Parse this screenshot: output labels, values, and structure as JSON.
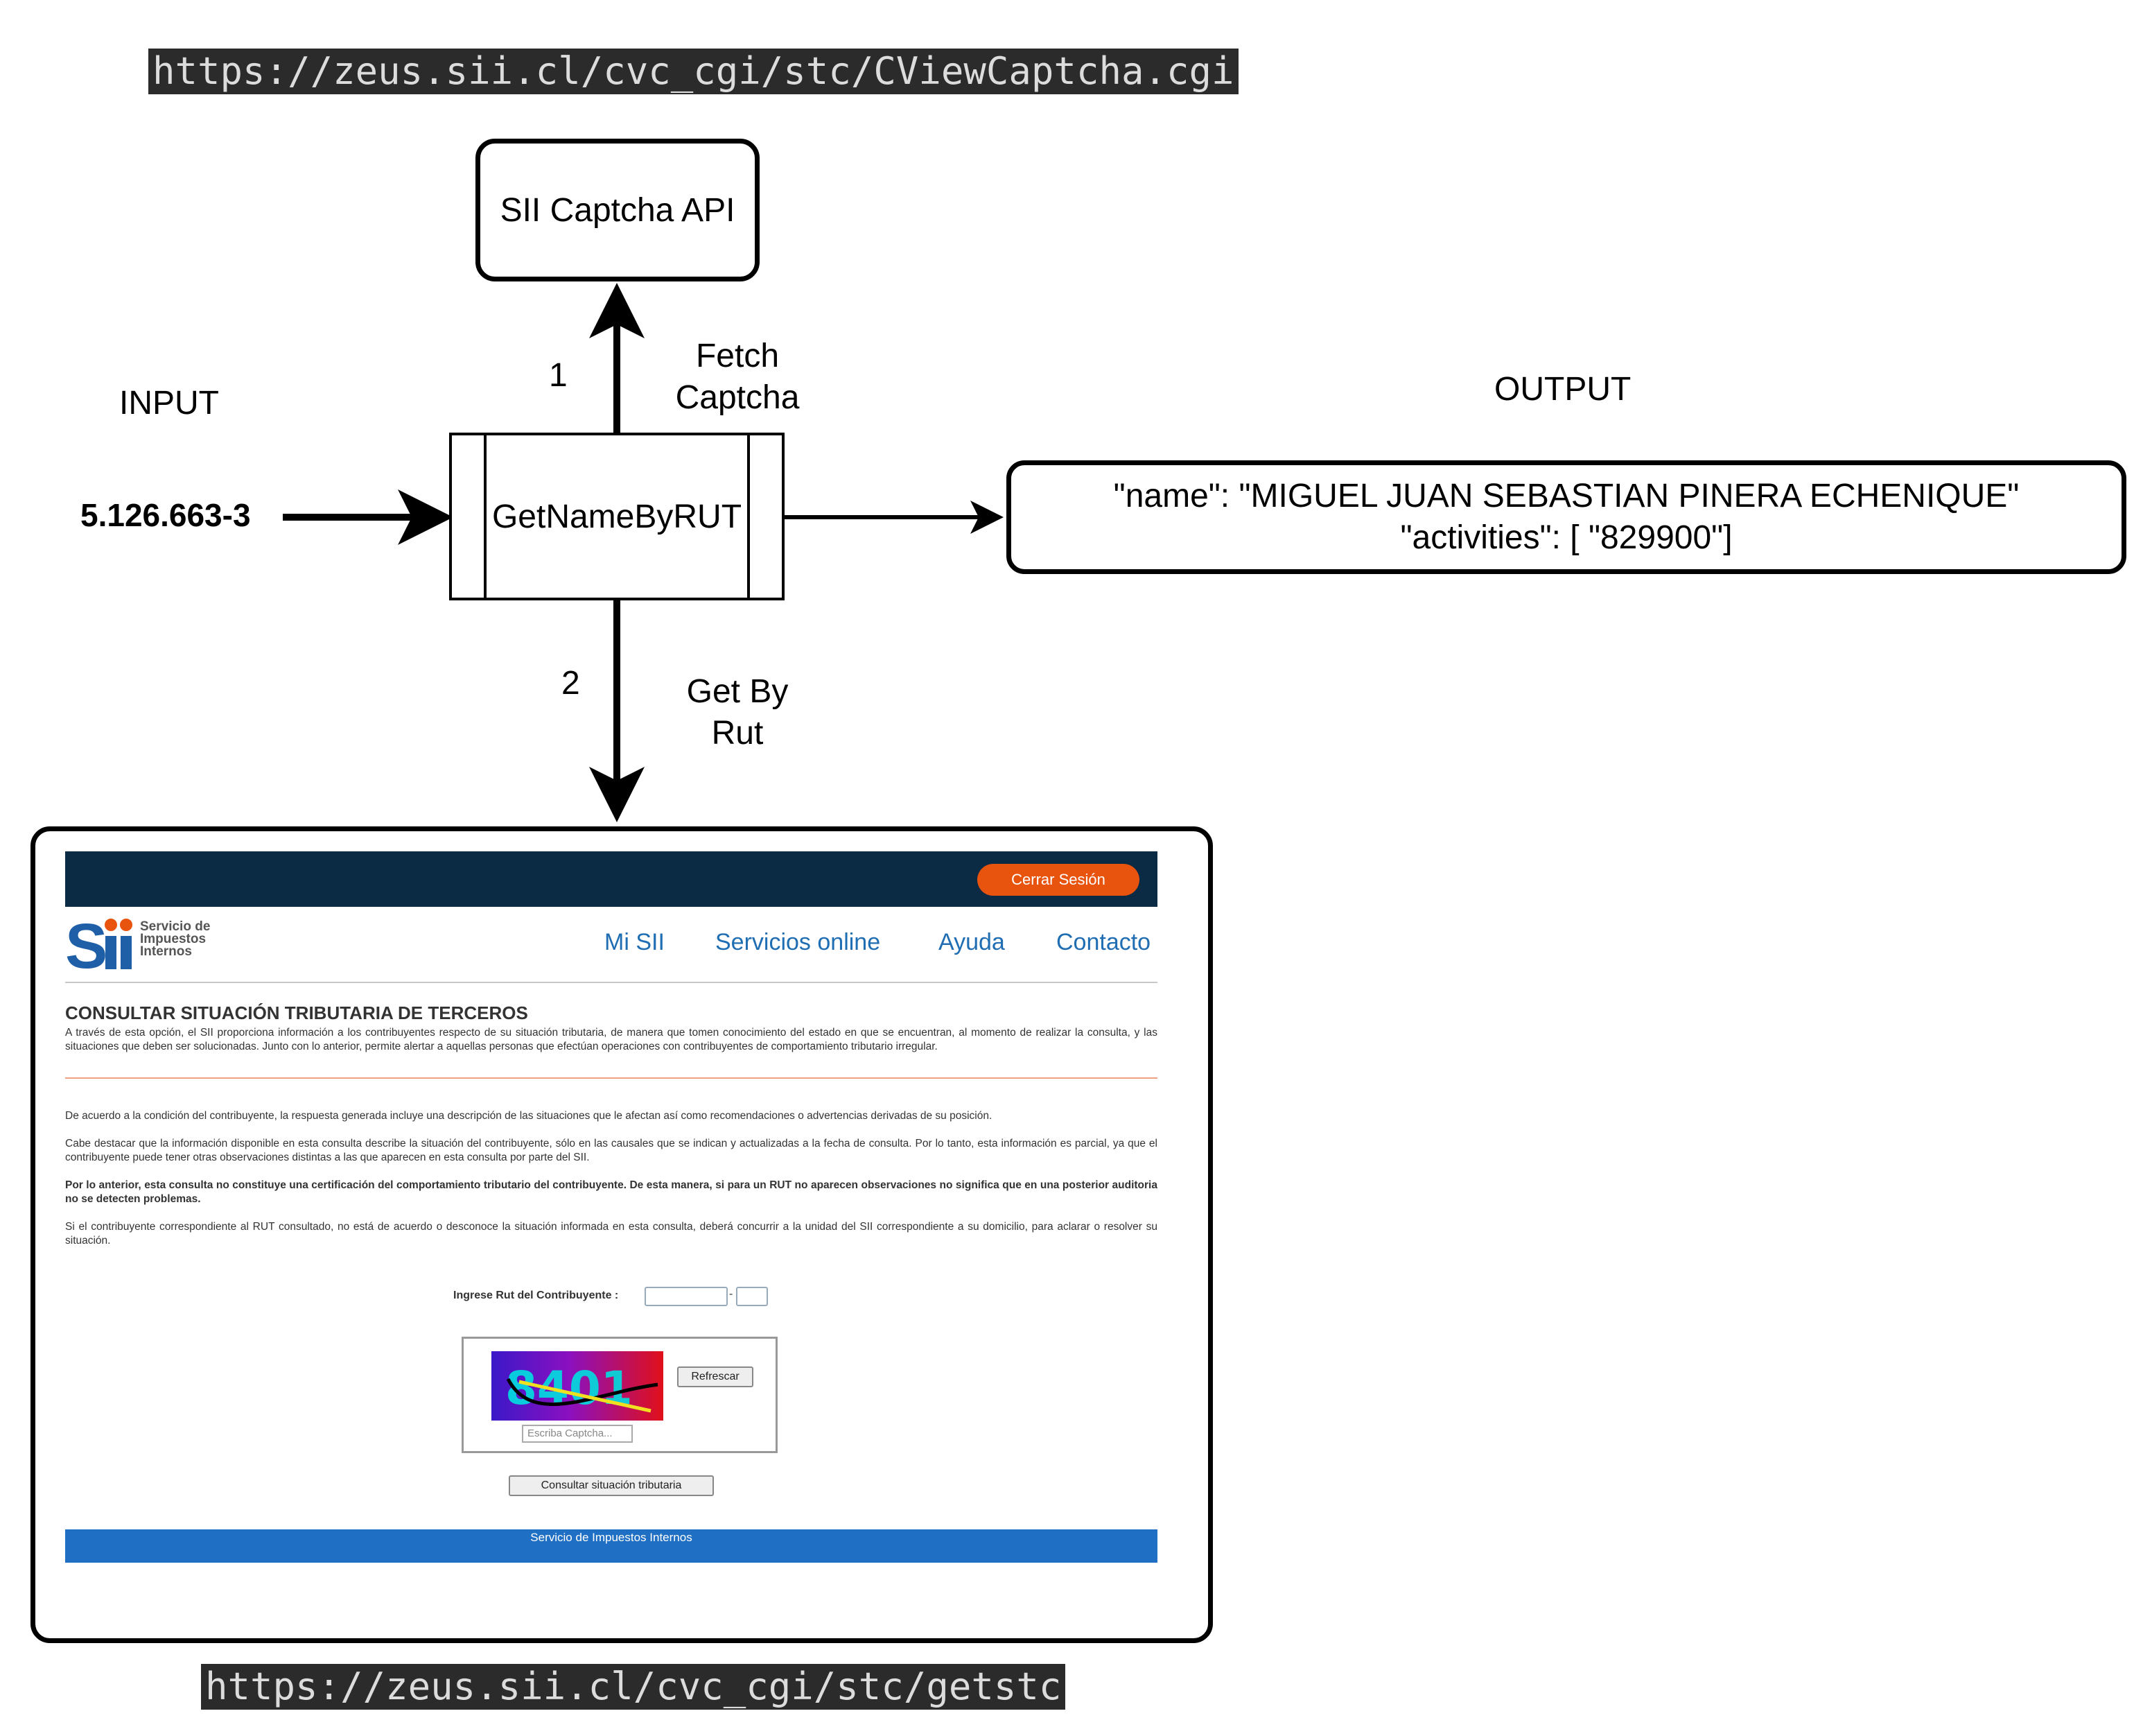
{
  "urls": {
    "captcha": "https://zeus.sii.cl/cvc_cgi/stc/CViewCaptcha.cgi",
    "getstc": "https://zeus.sii.cl/cvc_cgi/stc/getstc"
  },
  "nodes": {
    "captcha_api": "SII Captcha API",
    "get_name": "GetNameByRUT"
  },
  "labels": {
    "input": "INPUT",
    "output": "OUTPUT",
    "step1_num": "1",
    "step1_line1": "Fetch",
    "step1_line2": "Captcha",
    "step2_num": "2",
    "step2_line1": "Get By",
    "step2_line2": "Rut"
  },
  "input_value": "5.126.663-3",
  "output": {
    "line1": "\"name\": \"MIGUEL JUAN SEBASTIAN PINERA ECHENIQUE\"",
    "line2": "\"activities\": [ \"829900\"]"
  },
  "sii_page": {
    "logout": "Cerrar Sesión",
    "logo_text": [
      "Servicio de",
      "Impuestos",
      "Internos"
    ],
    "nav": [
      "Mi SII",
      "Servicios online",
      "Ayuda",
      "Contacto"
    ],
    "heading": "CONSULTAR SITUACIÓN TRIBUTARIA DE TERCEROS",
    "intro": "A través de esta opción, el SII proporciona información a los contribuyentes respecto de su situación tributaria, de manera que tomen conocimiento del estado en que se encuentran, al momento de realizar la consulta, y las situaciones que deben ser solucionadas. Junto con lo anterior, permite alertar a aquellas personas que efectúan operaciones con contribuyentes de comportamiento tributario irregular.",
    "para1": "De acuerdo a la condición del contribuyente, la respuesta generada incluye una descripción de las situaciones que le afectan así como recomendaciones o advertencias derivadas de su posición.",
    "para2": "Cabe destacar que la información disponible en esta consulta describe la situación del contribuyente, sólo en las causales que se indican y actualizadas a la fecha de consulta. Por lo tanto, esta información es parcial, ya que el contribuyente puede tener otras observaciones distintas a las que aparecen en esta consulta por parte del SII.",
    "para3": "Por lo anterior, esta consulta no constituye una certificación del comportamiento tributario del contribuyente. De esta manera, si para un RUT no aparecen observaciones no significa que en una posterior auditoria no se detecten problemas.",
    "para4": "Si el contribuyente correspondiente al RUT consultado, no está de acuerdo o desconoce la situación informada en esta consulta, deberá concurrir a la unidad del SII correspondiente a su domicilio, para aclarar o resolver su situación.",
    "rut_label": "Ingrese Rut del Contribuyente :",
    "rut_sep": "-",
    "captcha_text": "8401",
    "refresh_button": "Refrescar",
    "captcha_placeholder": "Escriba Captcha...",
    "submit_button": "Consultar situación tributaria",
    "footer": "Servicio de Impuestos Internos"
  }
}
